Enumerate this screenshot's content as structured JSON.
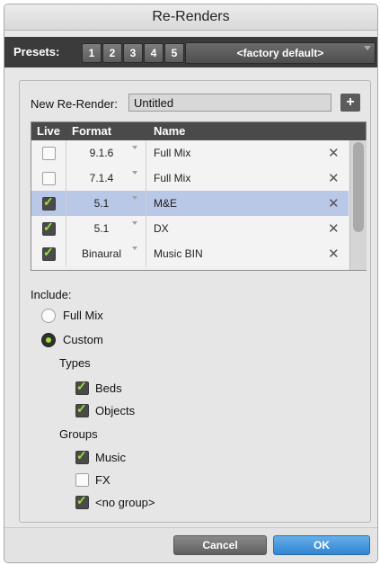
{
  "window": {
    "title": "Re-Renders"
  },
  "presets": {
    "label": "Presets:",
    "buttons": [
      "1",
      "2",
      "3",
      "4",
      "5"
    ],
    "selected": "<factory default>"
  },
  "new_rerender": {
    "label": "New Re-Render:",
    "value": "Untitled",
    "add_label": "+"
  },
  "table": {
    "headers": {
      "live": "Live",
      "format": "Format",
      "name": "Name"
    },
    "remove_glyph": "✕",
    "rows": [
      {
        "live": false,
        "format": "9.1.6",
        "name": "Full Mix",
        "selected": false
      },
      {
        "live": false,
        "format": "7.1.4",
        "name": "Full Mix",
        "selected": false
      },
      {
        "live": true,
        "format": "5.1",
        "name": "M&E",
        "selected": true
      },
      {
        "live": true,
        "format": "5.1",
        "name": "DX",
        "selected": false
      },
      {
        "live": true,
        "format": "Binaural",
        "name": "Music BIN",
        "selected": false
      }
    ]
  },
  "include": {
    "label": "Include:",
    "options": [
      {
        "label": "Full Mix",
        "selected": false
      },
      {
        "label": "Custom",
        "selected": true
      }
    ]
  },
  "types": {
    "label": "Types",
    "items": [
      {
        "label": "Beds",
        "checked": true
      },
      {
        "label": "Objects",
        "checked": true
      }
    ]
  },
  "groups": {
    "label": "Groups",
    "items": [
      {
        "label": "Music",
        "checked": true
      },
      {
        "label": "FX",
        "checked": false
      },
      {
        "label": "<no group>",
        "checked": true
      }
    ]
  },
  "footer": {
    "cancel_label": "Cancel",
    "ok_label": "OK"
  },
  "colors": {
    "accent_check": "#9be13a",
    "selected_row": "#b9c8e6",
    "ok_button": "#3a8fd8"
  }
}
